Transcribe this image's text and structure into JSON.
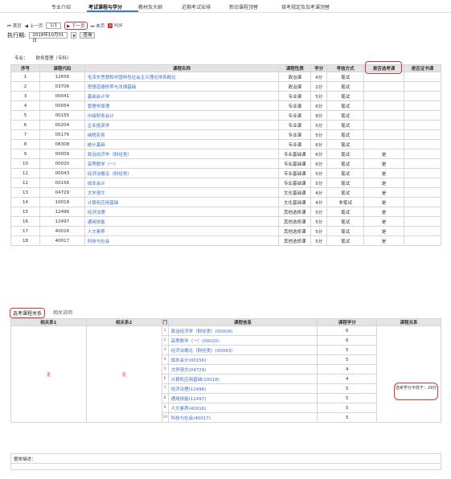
{
  "nav": {
    "tabs": [
      "专业介绍",
      "考试课程与学分",
      "教材及大纲",
      "近期考试安排",
      "新旧课程顶替",
      "接考规定及加考课顶替"
    ],
    "active": "考试课程与学分"
  },
  "toolbar": {
    "first": "首页",
    "prev": "上一页",
    "page": "1/1",
    "next": "下一页",
    "last": "末页",
    "pdf": "PDF"
  },
  "exec": {
    "label": "执行期:",
    "date": "2018年10月01日",
    "query": "查询"
  },
  "major": {
    "label": "专业：",
    "value": "财务管理（专科）"
  },
  "courses": {
    "headers": [
      "序号",
      "课程代码",
      "课程名称",
      "课程性质",
      "学分",
      "考核方式",
      "是否选考课",
      "是否证书课"
    ],
    "rows": [
      [
        "1",
        "12656",
        "毛泽东思想和中国特色社会主义理论体系概论",
        "政治课",
        "4分",
        "笔试",
        "",
        ""
      ],
      [
        "2",
        "03706",
        "思想道德修养与法律基础",
        "政治课",
        "2分",
        "笔试",
        "",
        ""
      ],
      [
        "3",
        "00041",
        "基础会计学",
        "专业课",
        "5分",
        "笔试",
        "",
        ""
      ],
      [
        "4",
        "00054",
        "管理学原理",
        "专业课",
        "6分",
        "笔试",
        "",
        ""
      ],
      [
        "5",
        "00155",
        "中级财务会计",
        "专业课",
        "8分",
        "笔试",
        "",
        ""
      ],
      [
        "6",
        "00204",
        "企业投资学",
        "专业课",
        "5分",
        "笔试",
        "",
        ""
      ],
      [
        "7",
        "05176",
        "纳税实务",
        "专业课",
        "5分",
        "笔试",
        "",
        ""
      ],
      [
        "8",
        "08308",
        "统计基础",
        "专业课",
        "6分",
        "笔试",
        "",
        ""
      ],
      [
        "9",
        "00009",
        "政治经济学（财经类）",
        "专业基础课",
        "6分",
        "笔试",
        "是",
        ""
      ],
      [
        "10",
        "00020",
        "高等数学（一）",
        "专业基础课",
        "6分",
        "笔试",
        "是",
        ""
      ],
      [
        "11",
        "00043",
        "经济法概论（财经类）",
        "专业基础课",
        "5分",
        "笔试",
        "是",
        ""
      ],
      [
        "12",
        "00156",
        "成本会计",
        "专业基础课",
        "5分",
        "笔试",
        "是",
        ""
      ],
      [
        "13",
        "04729",
        "大学语文",
        "文化基础课",
        "4分",
        "笔试",
        "是",
        ""
      ],
      [
        "14",
        "10018",
        "计算机应用基础",
        "文化基础课",
        "4分",
        "非笔试",
        "是",
        ""
      ],
      [
        "15",
        "12496",
        "经济法理",
        "其他选修课",
        "5分",
        "笔试",
        "是",
        ""
      ],
      [
        "16",
        "12497",
        "通用技能",
        "其他选修课",
        "5分",
        "笔试",
        "是",
        ""
      ],
      [
        "17",
        "40016",
        "人文素养",
        "其他选修课",
        "5分",
        "笔试",
        "是",
        ""
      ],
      [
        "18",
        "40017",
        "科技与社会",
        "其他选修课",
        "5分",
        "笔试",
        "是",
        ""
      ]
    ]
  },
  "tabs2": [
    "选考课程关系",
    "相关说明"
  ],
  "relation": {
    "headers": [
      "相关系1",
      "相关系2",
      "门",
      "课程信息",
      "课程学分",
      "课程关系"
    ],
    "rel1": "无",
    "rel2": "无",
    "relation_text": "选考学分不低于：29分",
    "rows": [
      [
        "1",
        "政治经济学（财经类）(00009)",
        "6"
      ],
      [
        "2",
        "高等数学（一）(00020)",
        "6"
      ],
      [
        "3",
        "经济法概论（财经类）(00043)",
        "5"
      ],
      [
        "4",
        "成本会计(00156)",
        "5"
      ],
      [
        "5",
        "大学语文(04729)",
        "4"
      ],
      [
        "6",
        "计算机应用基础(10018)",
        "4"
      ],
      [
        "7",
        "经济法理(12496)",
        "5"
      ],
      [
        "8",
        "通用技能(12497)",
        "5"
      ],
      [
        "9",
        "人文素养(40016)",
        "5"
      ],
      [
        "10",
        "科技与社会(40017)",
        "5"
      ]
    ]
  },
  "overall": {
    "label": "整体描述："
  }
}
